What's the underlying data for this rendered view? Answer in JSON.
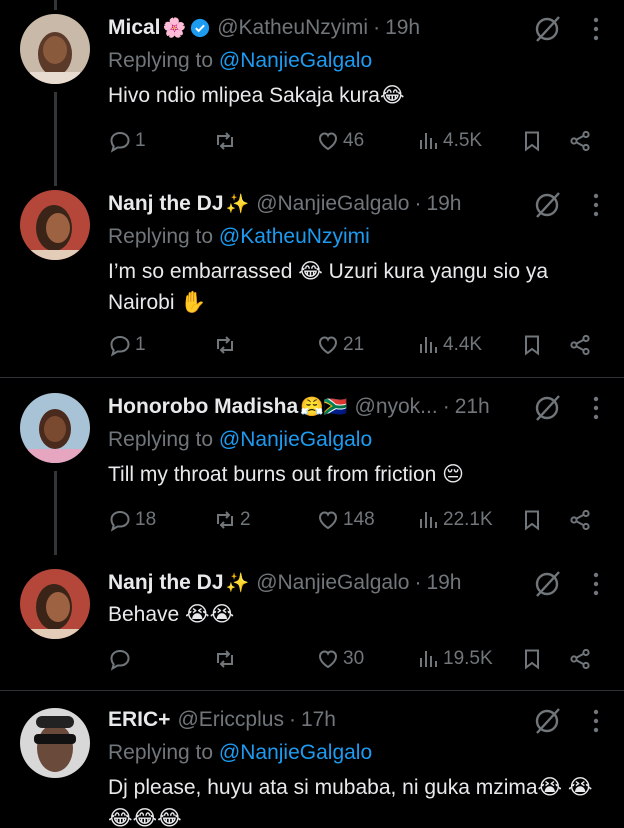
{
  "colors": {
    "background": "#000000",
    "text": "#e7e9ea",
    "muted": "#71767b",
    "link": "#1d9bf0",
    "divider": "#2f3336",
    "verified": "#1d9bf0"
  },
  "tweets": [
    {
      "name": "Mical",
      "name_emoji": "🌸",
      "verified": true,
      "handle": "@KatheuNzyimi",
      "dot": "·",
      "time": "19h",
      "replying_prefix": "Replying to",
      "replying_to": "@NanjieGalgalo",
      "text": "Hivo ndio mlipea Sakaja kura😂",
      "replies": "1",
      "reposts": "",
      "likes": "46",
      "views": "4.5K"
    },
    {
      "name": "Nanj the DJ",
      "name_emoji": "✨",
      "verified": false,
      "handle": "@NanjieGalgalo",
      "dot": "·",
      "time": "19h",
      "replying_prefix": "Replying to",
      "replying_to": "@KatheuNzyimi",
      "text": "I’m so embarrassed 😂 Uzuri kura yangu sio ya Nairobi ✋",
      "replies": "1",
      "reposts": "",
      "likes": "21",
      "views": "4.4K"
    },
    {
      "name": "Honorobo Madisha",
      "name_emoji": "😤🇿🇦",
      "verified": false,
      "handle": "@nyok...",
      "dot": "·",
      "time": "21h",
      "replying_prefix": "Replying to",
      "replying_to": "@NanjieGalgalo",
      "text": "Till my throat burns out from friction 😔",
      "replies": "18",
      "reposts": "2",
      "likes": "148",
      "views": "22.1K"
    },
    {
      "name": "Nanj the DJ",
      "name_emoji": "✨",
      "verified": false,
      "handle": "@NanjieGalgalo",
      "dot": "·",
      "time": "19h",
      "replying_prefix": "",
      "replying_to": "",
      "text": "Behave 😭😭",
      "replies": "",
      "reposts": "",
      "likes": "30",
      "views": "19.5K"
    },
    {
      "name": "ERIC+",
      "name_emoji": "",
      "verified": false,
      "handle": "@Ericcplus",
      "dot": "·",
      "time": "17h",
      "replying_prefix": "Replying to",
      "replying_to": "@NanjieGalgalo",
      "text": "Dj please, huyu ata si mubaba, ni guka mzima😭 😭😂😂😂",
      "replies": "",
      "reposts": "",
      "likes": "",
      "views": ""
    }
  ]
}
